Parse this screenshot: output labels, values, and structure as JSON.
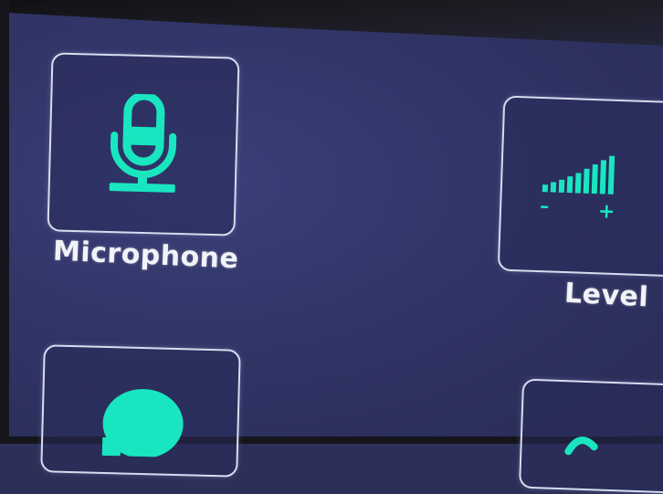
{
  "colors": {
    "screen_background": "#2f3363",
    "accent": "#19e6c0",
    "tile_border": "#d8dcf0",
    "label_text": "#f2f3f8"
  },
  "tiles": [
    {
      "label": "Microphone",
      "icon": "microphone-icon"
    },
    {
      "label": "Level",
      "icon": "level-bars-icon",
      "min_symbol": "–",
      "max_symbol": "+"
    },
    {
      "label": "",
      "icon": "person-icon"
    },
    {
      "label": "",
      "icon": "unknown-icon"
    }
  ]
}
